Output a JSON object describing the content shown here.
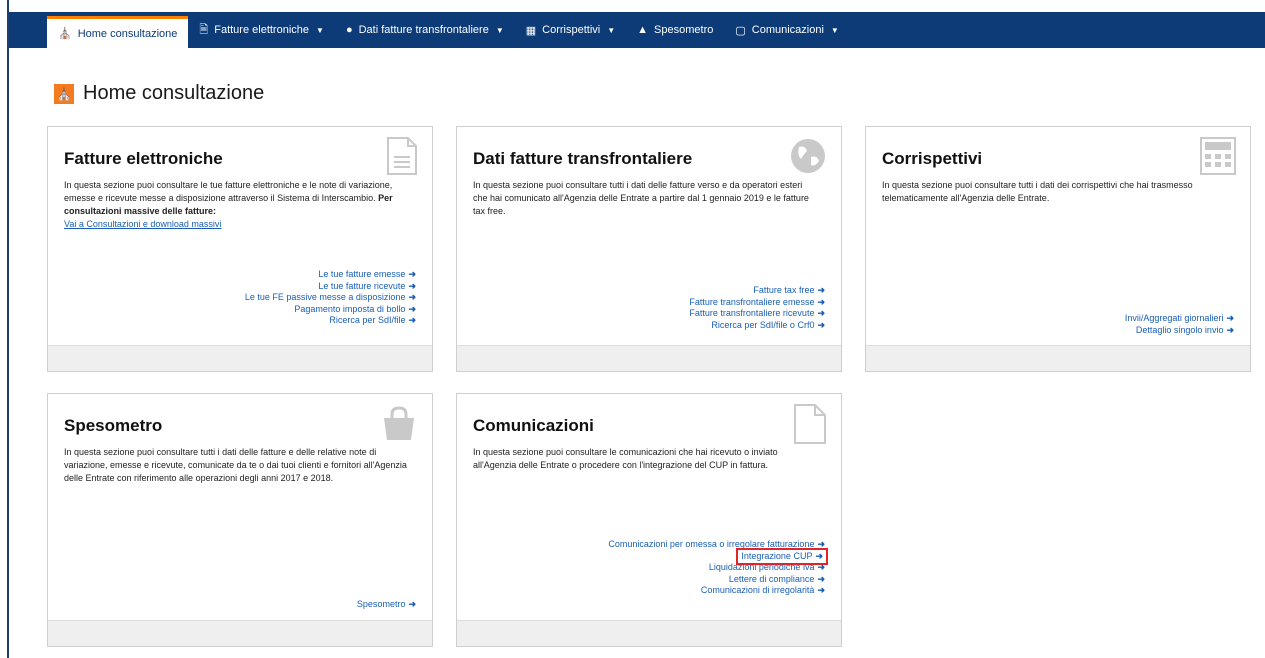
{
  "nav": {
    "items": [
      {
        "label": "Home consultazione",
        "icon": "home-icon",
        "caret": false,
        "active": true
      },
      {
        "label": "Fatture elettroniche",
        "icon": "document-icon",
        "caret": true,
        "active": false
      },
      {
        "label": "Dati fatture transfrontaliere",
        "icon": "globe-icon",
        "caret": true,
        "active": false
      },
      {
        "label": "Corrispettivi",
        "icon": "calculator-icon",
        "caret": true,
        "active": false
      },
      {
        "label": "Spesometro",
        "icon": "bag-icon",
        "caret": false,
        "active": false
      },
      {
        "label": "Comunicazioni",
        "icon": "file-icon",
        "caret": true,
        "active": false
      }
    ]
  },
  "page": {
    "title": "Home consultazione",
    "title_icon": "home-icon"
  },
  "cards": {
    "fatture": {
      "title": "Fatture elettroniche",
      "desc_text": "In questa sezione puoi consultare le tue fatture elettroniche e le note di variazione, emesse e ricevute messe a disposizione attraverso il Sistema di Interscambio.",
      "desc_bold": "Per consultazioni massive delle fatture:",
      "desc_link": "Vai a Consultazioni e download massivi",
      "links": [
        "Le tue fatture emesse",
        "Le tue fatture ricevute",
        "Le tue FE passive messe a disposizione",
        "Pagamento imposta di bollo",
        "Ricerca per SdI/file"
      ]
    },
    "transfrontaliere": {
      "title": "Dati fatture transfrontaliere",
      "desc_text": "In questa sezione puoi consultare tutti i dati delle fatture verso e da operatori esteri che hai comunicato all'Agenzia delle Entrate a partire dal 1 gennaio 2019 e le fatture tax free.",
      "links": [
        "Fatture tax free",
        "Fatture transfrontaliere emesse",
        "Fatture transfrontaliere ricevute",
        "Ricerca per SdI/file o Crf0"
      ]
    },
    "corrispettivi": {
      "title": "Corrispettivi",
      "desc_text": "In questa sezione puoi consultare tutti i dati dei corrispettivi che hai trasmesso telematicamente all'Agenzia delle Entrate.",
      "links": [
        "Invii/Aggregati giornalieri",
        "Dettaglio singolo invio"
      ]
    },
    "spesometro": {
      "title": "Spesometro",
      "desc_text": "In questa sezione puoi consultare tutti i dati delle fatture e delle relative note di variazione, emesse e ricevute, comunicate da te o dai tuoi clienti e fornitori all'Agenzia delle Entrate con riferimento alle operazioni degli anni 2017 e 2018.",
      "links": [
        "Spesometro"
      ]
    },
    "comunicazioni": {
      "title": "Comunicazioni",
      "desc_text": "In questa sezione puoi consultare le comunicazioni che hai ricevuto o inviato all'Agenzia delle Entrate o procedere con l'integrazione del CUP in fattura.",
      "links": [
        "Comunicazioni per omessa o irregolare fatturazione",
        "Integrazione CUP",
        "Liquidazioni periodiche iva",
        "Lettere di compliance",
        "Comunicazioni di irregolarità"
      ]
    }
  },
  "colors": {
    "navbar": "#0d3b78",
    "accent": "#f47b20",
    "link": "#1a5fb4",
    "highlight": "#e0242a"
  }
}
